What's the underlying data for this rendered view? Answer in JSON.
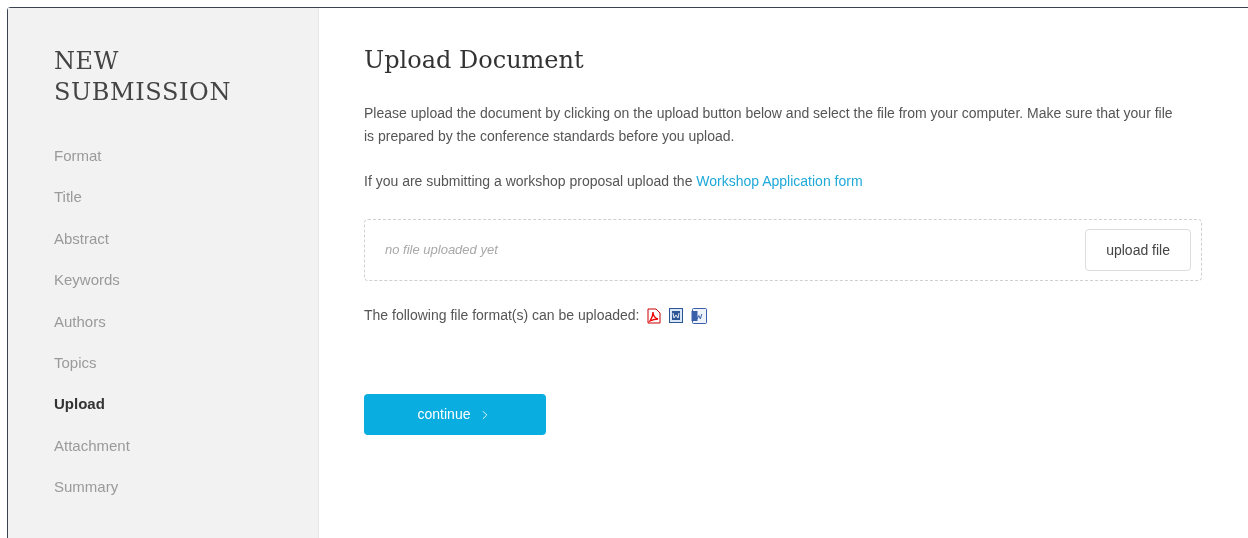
{
  "sidebar": {
    "title": "NEW SUBMISSION",
    "items": [
      {
        "label": "Format",
        "selected": false
      },
      {
        "label": "Title",
        "selected": false
      },
      {
        "label": "Abstract",
        "selected": false
      },
      {
        "label": "Keywords",
        "selected": false
      },
      {
        "label": "Authors",
        "selected": false
      },
      {
        "label": "Topics",
        "selected": false
      },
      {
        "label": "Upload",
        "selected": true
      },
      {
        "label": "Attachment",
        "selected": false
      },
      {
        "label": "Summary",
        "selected": false
      }
    ]
  },
  "main": {
    "title": "Upload Document",
    "intro": "Please upload the document by clicking on the upload button below and select the file from your computer. Make sure that your file is prepared by the conference standards before you upload.",
    "workshop_text": "If you are submitting a workshop proposal upload the",
    "workshop_link": "Workshop Application form",
    "upload_status": "no file uploaded yet",
    "upload_button": "upload file",
    "formats_text": "The following file format(s) can be uploaded:",
    "formats": [
      {
        "kind": "pdf"
      },
      {
        "kind": "doc"
      },
      {
        "kind": "docx"
      }
    ],
    "continue_button": "continue"
  }
}
